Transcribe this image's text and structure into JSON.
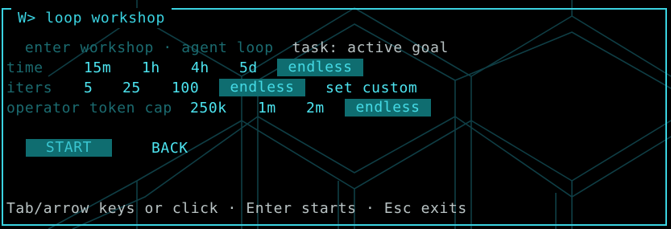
{
  "window": {
    "title": "W> loop workshop"
  },
  "header": {
    "mode_label": "enter workshop · agent loop",
    "task_label": "task: active goal"
  },
  "time": {
    "label": "time",
    "options": [
      "15m",
      "1h",
      "4h",
      "5d"
    ],
    "selected": "endless"
  },
  "iters": {
    "label": "iters",
    "options": [
      "5",
      "25",
      "100"
    ],
    "selected": "endless",
    "custom": "set custom"
  },
  "token_cap": {
    "label": "operator token cap",
    "options": [
      "250k",
      "1m",
      "2m"
    ],
    "selected": "endless"
  },
  "actions": {
    "start": "START",
    "back": "BACK"
  },
  "footer": {
    "help": "Tab/arrow keys or click · Enter starts · Esc exits"
  },
  "colors": {
    "accent": "#3ad2e0",
    "selected_bg": "#0f6d70",
    "dim": "#1b6b70",
    "text": "#b9c3c4"
  }
}
